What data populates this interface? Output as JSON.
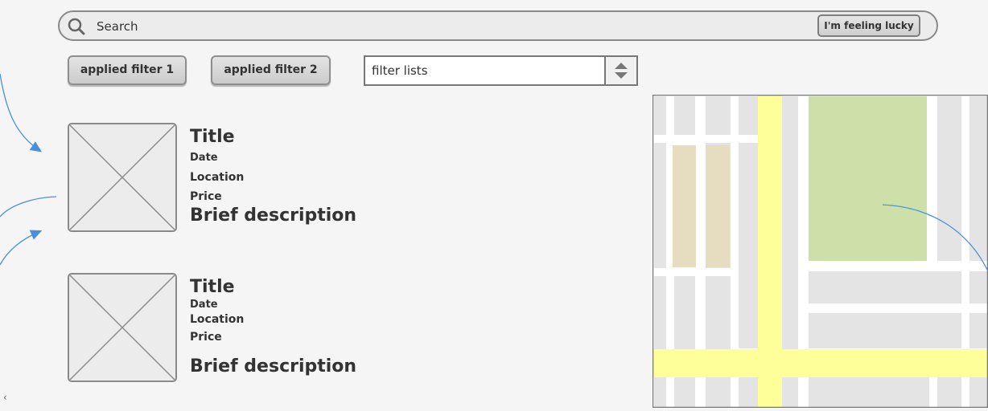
{
  "search": {
    "placeholder": "Search",
    "lucky_label": "I'm feeling lucky"
  },
  "filters": {
    "applied": [
      {
        "label": "applied filter 1"
      },
      {
        "label": "applied filter 2"
      }
    ],
    "list_select": {
      "value": "filter lists"
    }
  },
  "listings": [
    {
      "title": "Title",
      "date": "Date",
      "location": "Location",
      "price": "Price",
      "description": "Brief description"
    },
    {
      "title": "Title",
      "date": "Date",
      "location": "Location",
      "price": "Price",
      "description": "Brief description"
    }
  ],
  "map": {
    "icon": "map-placeholder",
    "road_color": "#ffff99",
    "park_color": "#cde0aa",
    "building_color": "#e6dcbf",
    "block_color": "#e4e4e4"
  },
  "colors": {
    "background": "#f5f5f5",
    "annotation": "#4a90d9"
  },
  "icons": {
    "search": "search-icon",
    "stepper": "up-down-stepper-icon",
    "image_placeholder": "image-placeholder-icon"
  }
}
